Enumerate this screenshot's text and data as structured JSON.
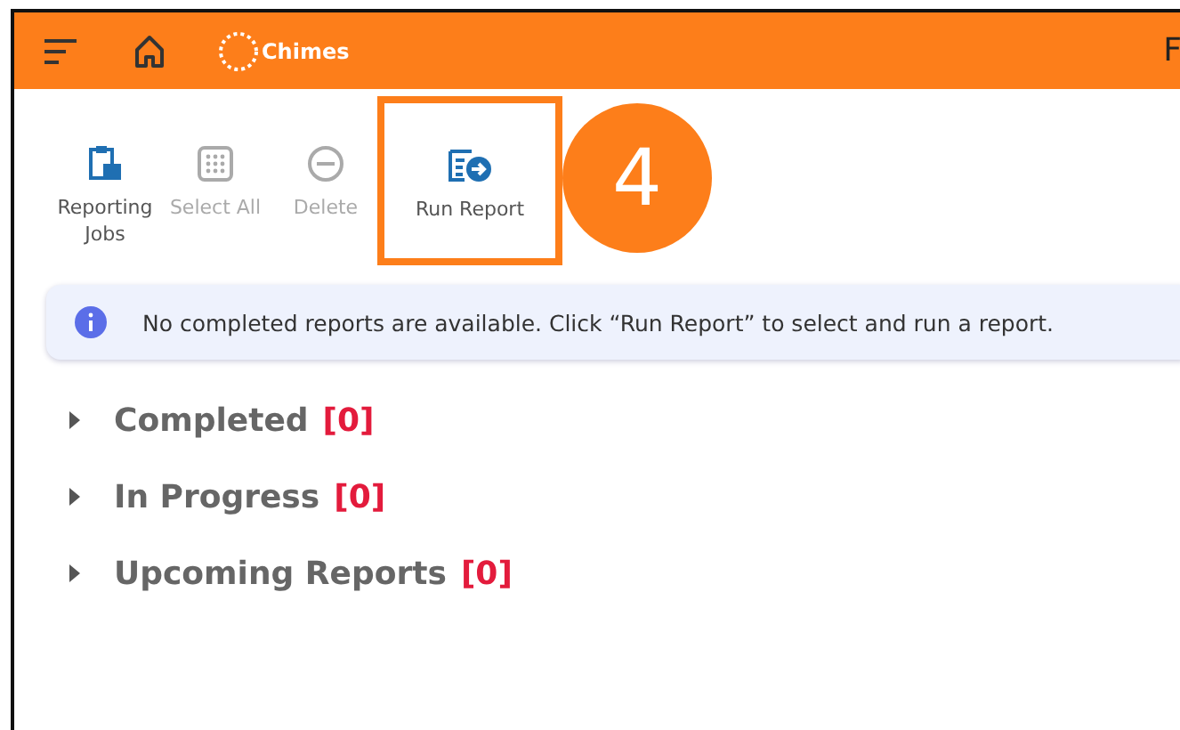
{
  "header": {
    "logo_text": "Chimes",
    "cut_title": "F"
  },
  "toolbar": [
    {
      "kind": "jobs",
      "label": "Reporting Jobs",
      "disabled": false,
      "highlighted": false
    },
    {
      "kind": "select",
      "label": "Select All",
      "disabled": true,
      "highlighted": false
    },
    {
      "kind": "delete",
      "label": "Delete",
      "disabled": true,
      "highlighted": false
    },
    {
      "kind": "run",
      "label": "Run Report",
      "disabled": false,
      "highlighted": true
    }
  ],
  "step_badge": "4",
  "info_message": "No completed reports are available. Click “Run Report” to select and run a report.",
  "sections": [
    {
      "title": "Completed",
      "count": "[0]",
      "expanded": false
    },
    {
      "title": "In Progress",
      "count": "[0]",
      "expanded": false
    },
    {
      "title": "Upcoming Reports",
      "count": "[0]",
      "expanded": false
    }
  ]
}
